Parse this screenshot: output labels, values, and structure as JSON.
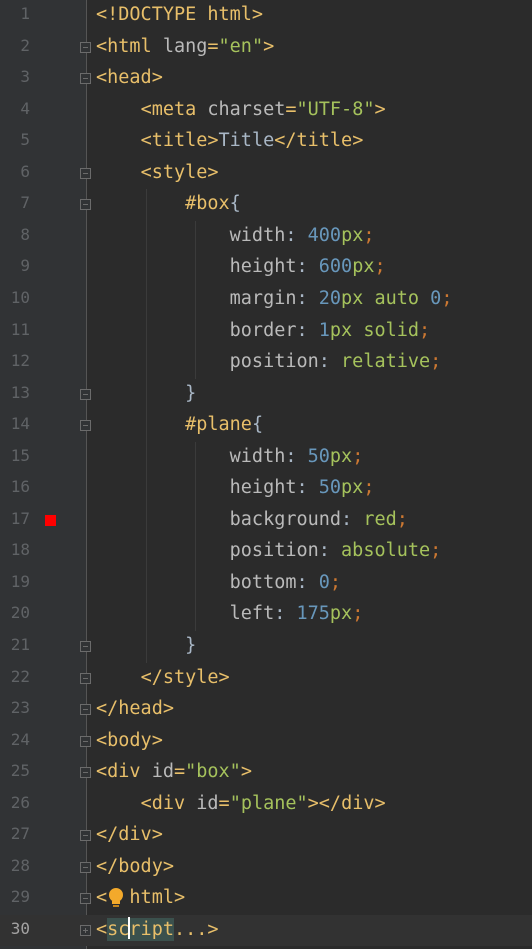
{
  "editor": {
    "language": "HTML",
    "current_line": 30,
    "breakpoint_line": 17,
    "lines": [
      {
        "n": "1",
        "segments": [
          [
            "tag",
            "<!DOCTYPE html>"
          ]
        ]
      },
      {
        "n": "2",
        "segments": [
          [
            "tag",
            "<html "
          ],
          [
            "attr",
            "lang"
          ],
          [
            "tag",
            "="
          ],
          [
            "str",
            "\"en\""
          ],
          [
            "tag",
            ">"
          ]
        ]
      },
      {
        "n": "3",
        "segments": [
          [
            "tag",
            "<head>"
          ]
        ]
      },
      {
        "n": "4",
        "segments": [
          [
            "plain",
            "    "
          ],
          [
            "tag",
            "<meta "
          ],
          [
            "attr",
            "charset"
          ],
          [
            "tag",
            "="
          ],
          [
            "str",
            "\"UTF-8\""
          ],
          [
            "tag",
            ">"
          ]
        ]
      },
      {
        "n": "5",
        "segments": [
          [
            "plain",
            "    "
          ],
          [
            "tag",
            "<title>"
          ],
          [
            "plain",
            "Title"
          ],
          [
            "tag",
            "</title>"
          ]
        ]
      },
      {
        "n": "6",
        "segments": [
          [
            "plain",
            "    "
          ],
          [
            "tag",
            "<style>"
          ]
        ]
      },
      {
        "n": "7",
        "segments": [
          [
            "plain",
            "        "
          ],
          [
            "sel",
            "#box"
          ],
          [
            "plain",
            "{"
          ]
        ]
      },
      {
        "n": "8",
        "segments": [
          [
            "plain",
            "            "
          ],
          [
            "prop",
            "width"
          ],
          [
            "plain",
            ": "
          ],
          [
            "num",
            "400"
          ],
          [
            "unit",
            "px"
          ],
          [
            "punct",
            ";"
          ]
        ]
      },
      {
        "n": "9",
        "segments": [
          [
            "plain",
            "            "
          ],
          [
            "prop",
            "height"
          ],
          [
            "plain",
            ": "
          ],
          [
            "num",
            "600"
          ],
          [
            "unit",
            "px"
          ],
          [
            "punct",
            ";"
          ]
        ]
      },
      {
        "n": "10",
        "segments": [
          [
            "plain",
            "            "
          ],
          [
            "prop",
            "margin"
          ],
          [
            "plain",
            ": "
          ],
          [
            "num",
            "20"
          ],
          [
            "unit",
            "px"
          ],
          [
            "plain",
            " "
          ],
          [
            "kw",
            "auto"
          ],
          [
            "plain",
            " "
          ],
          [
            "num",
            "0"
          ],
          [
            "punct",
            ";"
          ]
        ]
      },
      {
        "n": "11",
        "segments": [
          [
            "plain",
            "            "
          ],
          [
            "prop",
            "border"
          ],
          [
            "plain",
            ": "
          ],
          [
            "num",
            "1"
          ],
          [
            "unit",
            "px"
          ],
          [
            "plain",
            " "
          ],
          [
            "kw",
            "solid"
          ],
          [
            "punct",
            ";"
          ]
        ]
      },
      {
        "n": "12",
        "segments": [
          [
            "plain",
            "            "
          ],
          [
            "prop",
            "position"
          ],
          [
            "plain",
            ": "
          ],
          [
            "kw",
            "relative"
          ],
          [
            "punct",
            ";"
          ]
        ]
      },
      {
        "n": "13",
        "segments": [
          [
            "plain",
            "        }"
          ]
        ]
      },
      {
        "n": "14",
        "segments": [
          [
            "plain",
            "        "
          ],
          [
            "sel",
            "#plane"
          ],
          [
            "plain",
            "{"
          ]
        ]
      },
      {
        "n": "15",
        "segments": [
          [
            "plain",
            "            "
          ],
          [
            "prop",
            "width"
          ],
          [
            "plain",
            ": "
          ],
          [
            "num",
            "50"
          ],
          [
            "unit",
            "px"
          ],
          [
            "punct",
            ";"
          ]
        ]
      },
      {
        "n": "16",
        "segments": [
          [
            "plain",
            "            "
          ],
          [
            "prop",
            "height"
          ],
          [
            "plain",
            ": "
          ],
          [
            "num",
            "50"
          ],
          [
            "unit",
            "px"
          ],
          [
            "punct",
            ";"
          ]
        ]
      },
      {
        "n": "17",
        "segments": [
          [
            "plain",
            "            "
          ],
          [
            "prop",
            "background"
          ],
          [
            "plain",
            ": "
          ],
          [
            "kw",
            "red"
          ],
          [
            "punct",
            ";"
          ]
        ]
      },
      {
        "n": "18",
        "segments": [
          [
            "plain",
            "            "
          ],
          [
            "prop",
            "position"
          ],
          [
            "plain",
            ": "
          ],
          [
            "kw",
            "absolute"
          ],
          [
            "punct",
            ";"
          ]
        ]
      },
      {
        "n": "19",
        "segments": [
          [
            "plain",
            "            "
          ],
          [
            "prop",
            "bottom"
          ],
          [
            "plain",
            ": "
          ],
          [
            "num",
            "0"
          ],
          [
            "punct",
            ";"
          ]
        ]
      },
      {
        "n": "20",
        "segments": [
          [
            "plain",
            "            "
          ],
          [
            "prop",
            "left"
          ],
          [
            "plain",
            ": "
          ],
          [
            "num",
            "175"
          ],
          [
            "unit",
            "px"
          ],
          [
            "punct",
            ";"
          ]
        ]
      },
      {
        "n": "21",
        "segments": [
          [
            "plain",
            "        }"
          ]
        ]
      },
      {
        "n": "22",
        "segments": [
          [
            "plain",
            "    "
          ],
          [
            "tag",
            "</style>"
          ]
        ]
      },
      {
        "n": "23",
        "segments": [
          [
            "tag",
            "</head>"
          ]
        ]
      },
      {
        "n": "24",
        "segments": [
          [
            "tag",
            "<body>"
          ]
        ]
      },
      {
        "n": "25",
        "segments": [
          [
            "tag",
            "<div "
          ],
          [
            "attr",
            "id"
          ],
          [
            "tag",
            "="
          ],
          [
            "str",
            "\"box\""
          ],
          [
            "tag",
            ">"
          ]
        ]
      },
      {
        "n": "26",
        "segments": [
          [
            "plain",
            "    "
          ],
          [
            "tag",
            "<div "
          ],
          [
            "attr",
            "id"
          ],
          [
            "tag",
            "="
          ],
          [
            "str",
            "\"plane\""
          ],
          [
            "tag",
            "></div>"
          ]
        ]
      },
      {
        "n": "27",
        "segments": [
          [
            "tag",
            "</div>"
          ]
        ]
      },
      {
        "n": "28",
        "segments": [
          [
            "tag",
            "</body>"
          ]
        ]
      },
      {
        "n": "29",
        "segments": [
          [
            "tag",
            "<"
          ],
          [
            "plain",
            "  "
          ],
          [
            "tag",
            "html>"
          ]
        ]
      },
      {
        "n": "30",
        "segments": [
          [
            "tag",
            "<"
          ],
          [
            "folded",
            "sc|ript"
          ],
          [
            "tag",
            "...>"
          ]
        ]
      }
    ],
    "fold_markers": [
      {
        "line": 2,
        "kind": "open"
      },
      {
        "line": 3,
        "kind": "open"
      },
      {
        "line": 6,
        "kind": "open"
      },
      {
        "line": 7,
        "kind": "open"
      },
      {
        "line": 13,
        "kind": "close"
      },
      {
        "line": 14,
        "kind": "open"
      },
      {
        "line": 21,
        "kind": "close"
      },
      {
        "line": 22,
        "kind": "close"
      },
      {
        "line": 23,
        "kind": "close"
      },
      {
        "line": 24,
        "kind": "open"
      },
      {
        "line": 25,
        "kind": "open"
      },
      {
        "line": 27,
        "kind": "close"
      },
      {
        "line": 28,
        "kind": "close"
      },
      {
        "line": 29,
        "kind": "close"
      },
      {
        "line": 30,
        "kind": "plus"
      }
    ],
    "colors": {
      "background": "#2b2b2b",
      "gutter": "#313335",
      "tag": "#e8bf6a",
      "string": "#a5c25c",
      "number": "#6897bb",
      "punctuation": "#cc7832",
      "breakpoint": "#ff0000"
    },
    "icons": {
      "intention_bulb": "lightbulb-icon",
      "breakpoint": "breakpoint-icon"
    }
  }
}
